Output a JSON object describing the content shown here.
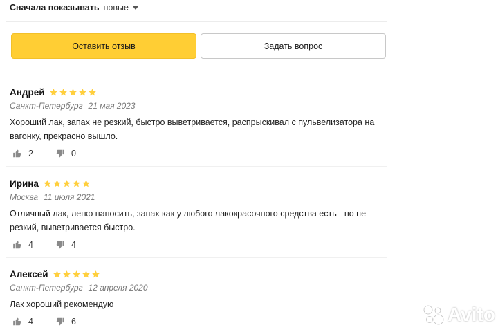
{
  "sort": {
    "label": "Сначала показывать",
    "value": "новые"
  },
  "actions": {
    "leave_review": "Оставить отзыв",
    "ask_question": "Задать вопрос"
  },
  "colors": {
    "accent": "#ffce34",
    "star": "#ffcf3d",
    "icon": "#8a8a8a"
  },
  "reviews": [
    {
      "name": "Андрей",
      "rating": 5,
      "city": "Санкт-Петербург",
      "date": "21 мая 2023",
      "text": "Хороший лак, запах не резкий, быстро выветривается, распрыскивал с пульвелизатора на вагонку, прекрасно вышло.",
      "likes": "2",
      "dislikes": "0"
    },
    {
      "name": "Ирина",
      "rating": 5,
      "city": "Москва",
      "date": "11 июля 2021",
      "text": "Отличный лак, легко наносить, запах как у любого лакокрасочного средства есть - но не резкий, выветривается быстро.",
      "likes": "4",
      "dislikes": "4"
    },
    {
      "name": "Алексей",
      "rating": 5,
      "city": "Санкт-Петербург",
      "date": "12 апреля 2020",
      "text": "Лак хороший рекомендую",
      "likes": "4",
      "dislikes": "6"
    }
  ],
  "watermark": {
    "text": "Avito"
  }
}
